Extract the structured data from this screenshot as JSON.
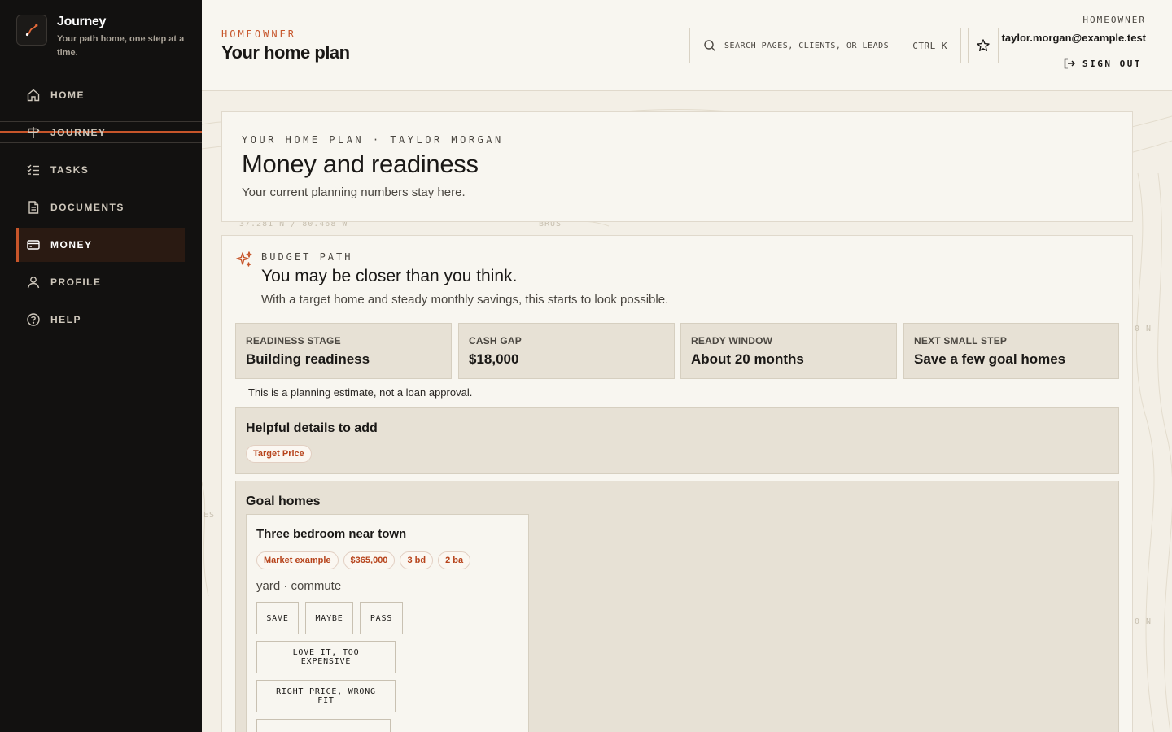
{
  "brand": {
    "name": "Journey",
    "tagline": "Your path home, one step at a time."
  },
  "nav": [
    {
      "label": "HOME",
      "icon": "home-icon"
    },
    {
      "label": "JOURNEY",
      "icon": "signpost-icon"
    },
    {
      "label": "TASKS",
      "icon": "checklist-icon"
    },
    {
      "label": "DOCUMENTS",
      "icon": "document-icon"
    },
    {
      "label": "MONEY",
      "icon": "card-icon",
      "active": true
    },
    {
      "label": "PROFILE",
      "icon": "user-icon"
    },
    {
      "label": "HELP",
      "icon": "help-icon"
    }
  ],
  "header": {
    "eyebrow": "HOMEOWNER",
    "title": "Your home plan",
    "search_placeholder": "SEARCH PAGES, CLIENTS, OR LEADS",
    "shortcut": "CTRL K",
    "role": "HOMEOWNER",
    "email": "taylor.morgan@example.test",
    "sign_out": "SIGN OUT"
  },
  "map": {
    "coord_1": "37.281 N / 80.468 W",
    "label_1": "BRUS",
    "label_2": "ES",
    "edge_1": "0 N",
    "edge_2": "0 N"
  },
  "intro": {
    "eyebrow": "YOUR HOME PLAN · TAYLOR MORGAN",
    "title": "Money and readiness",
    "subtitle": "Your current planning numbers stay here."
  },
  "budget": {
    "eyebrow": "BUDGET PATH",
    "title": "You may be closer than you think.",
    "subtitle": "With a target home and steady monthly savings, this starts to look possible.",
    "stats": [
      {
        "label": "READINESS STAGE",
        "value": "Building readiness"
      },
      {
        "label": "CASH GAP",
        "value": "$18,000"
      },
      {
        "label": "READY WINDOW",
        "value": "About 20 months"
      },
      {
        "label": "NEXT SMALL STEP",
        "value": "Save a few goal homes"
      }
    ],
    "disclaimer": "This is a planning estimate, not a loan approval."
  },
  "helpful": {
    "title": "Helpful details to add",
    "chip": "Target Price"
  },
  "goals": {
    "title": "Goal homes",
    "home": {
      "title": "Three bedroom near town",
      "chips": [
        "Market example",
        "$365,000",
        "3 bd",
        "2 ba"
      ],
      "meta": "yard · commute",
      "actions": [
        "SAVE",
        "MAYBE",
        "PASS",
        "LOVE IT, TOO EXPENSIVE",
        "RIGHT PRICE, WRONG FIT"
      ]
    }
  },
  "colors": {
    "accent": "#c7552a",
    "sidebar": "#121110",
    "panel": "#e7e1d5",
    "surface": "#f8f6f0"
  }
}
